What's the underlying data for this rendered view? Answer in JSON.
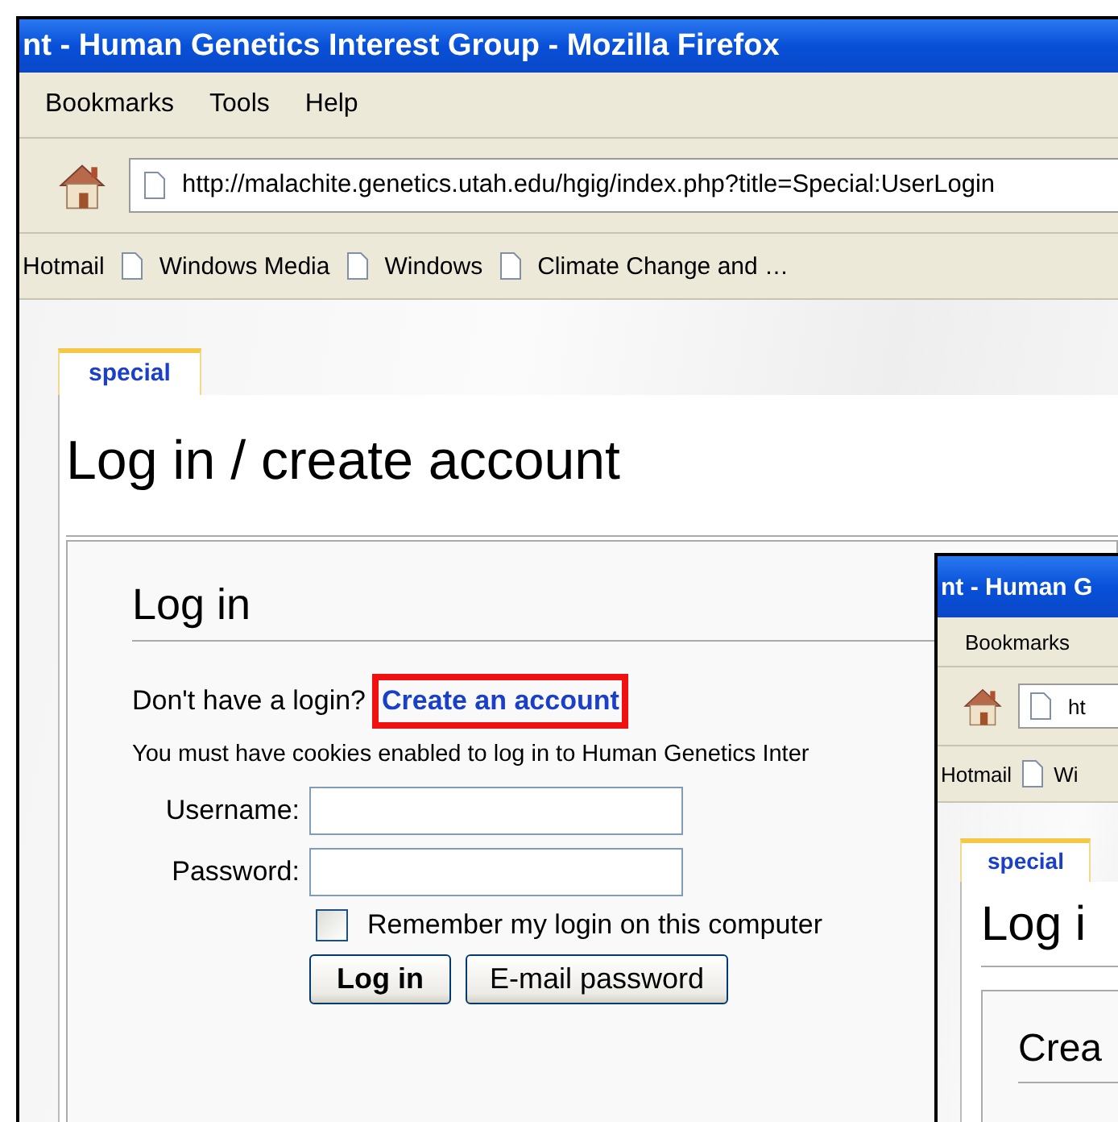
{
  "main_window": {
    "title": "nt - Human Genetics Interest Group - Mozilla Firefox",
    "menu": [
      "Bookmarks",
      "Tools",
      "Help"
    ],
    "address": "http://malachite.genetics.utah.edu/hgig/index.php?title=Special:UserLogin",
    "bookmarks": [
      "Hotmail",
      "Windows Media",
      "Windows",
      "Climate Change and …"
    ],
    "tab": {
      "label": "special",
      "selected": true
    },
    "heading": "Log in / create account",
    "login": {
      "title": "Log in",
      "prompt": "Don't have a login?",
      "link": {
        "label": "Create an account",
        "highlighted": true
      },
      "note": "You must have cookies enabled to log in to Human Genetics Inter",
      "fields": [
        {
          "label": "Username:"
        },
        {
          "label": "Password:"
        }
      ],
      "remember": {
        "label": "Remember my login on this computer",
        "checked": false
      },
      "buttons": [
        "Log in",
        "E-mail password"
      ]
    }
  },
  "inset_window": {
    "title": "nt - Human G",
    "menu": [
      "Bookmarks"
    ],
    "address": "ht",
    "bookmarks": [
      "Hotmail",
      "Wi"
    ],
    "tab": {
      "label": "special",
      "selected": true
    },
    "heading": "Log i",
    "section_title": "Crea"
  }
}
